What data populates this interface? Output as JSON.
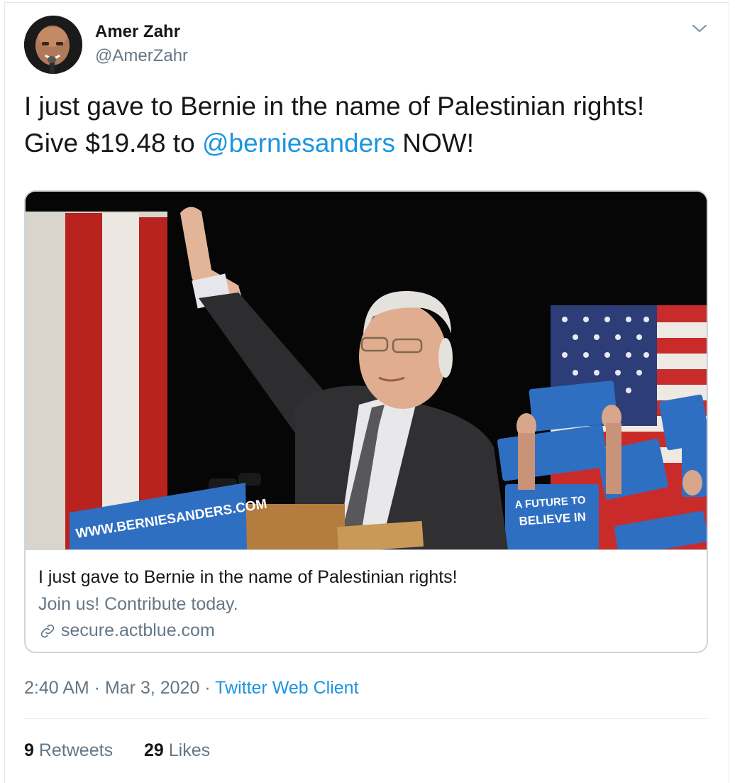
{
  "author": {
    "name": "Amer Zahr",
    "handle": "@AmerZahr"
  },
  "tweet": {
    "text_line1": "I just gave to Bernie in the name of Palestinian rights!",
    "text_line2_prefix": "Give $19.48 to ",
    "mention": "@berniesanders",
    "text_line2_suffix": " NOW!"
  },
  "link_card": {
    "image_sign_text": "WWW.BERNIESANDERS.COM",
    "image_placard_text": "A FUTURE TO BELIEVE IN",
    "title": "I just gave to Bernie in the name of Palestinian rights!",
    "description": "Join us! Contribute today.",
    "domain": "secure.actblue.com"
  },
  "meta": {
    "time": "2:40 AM",
    "separator": " · ",
    "date": "Mar 3, 2020",
    "source": "Twitter Web Client"
  },
  "stats": {
    "retweets_count": "9",
    "retweets_label": " Retweets",
    "likes_count": "29",
    "likes_label": " Likes"
  },
  "colors": {
    "link_blue": "#1b95e0",
    "secondary_gray": "#657786",
    "text_dark": "#14171a",
    "border": "#e1e8ed"
  },
  "icons": [
    "chevron-down-icon",
    "link-icon"
  ]
}
